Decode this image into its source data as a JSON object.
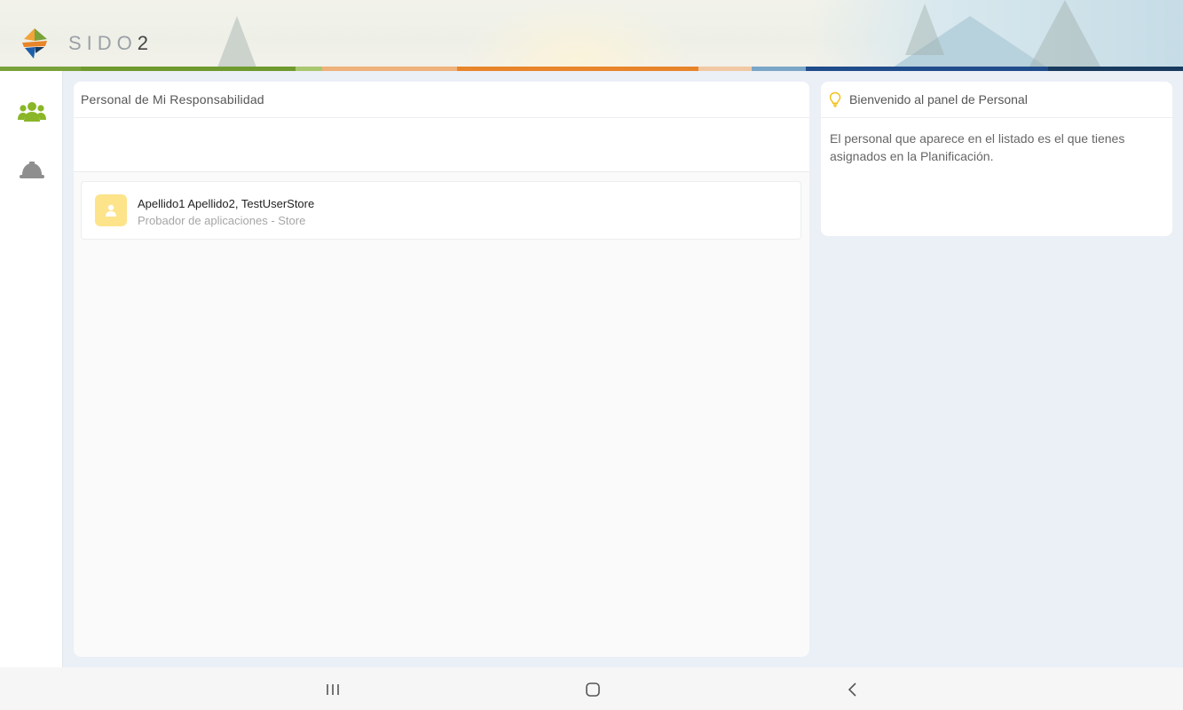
{
  "header": {
    "brand_text": "SIDO",
    "brand_number": "2",
    "logo_icon": "sido-logo-icon",
    "stripe_colors": [
      "#7aa23a",
      "#7aa23a",
      "#a9c76f",
      "#eeb27a",
      "#e8852a",
      "#f0c9a3",
      "#7aa6c7",
      "#1f4c8a",
      "#173a5e"
    ]
  },
  "sidebar": {
    "items": [
      {
        "icon": "users-icon",
        "color": "#8ab627"
      },
      {
        "icon": "hard-hat-icon",
        "color": "#8e8e8e"
      }
    ]
  },
  "main": {
    "title": "Personal de Mi Responsabilidad",
    "people": [
      {
        "name": "Apellido1 Apellido2, TestUserStore",
        "role": "Probador de aplicaciones - Store",
        "icon": "user-avatar-icon",
        "avatar_color": "#fde38a"
      }
    ]
  },
  "info": {
    "icon": "lightbulb-icon",
    "title": "Bienvenido al panel de Personal",
    "body": "El personal que aparece en el listado es el que tienes asignados en la Planificación."
  },
  "navbar": {
    "items": [
      "recent-apps-icon",
      "home-icon",
      "back-icon"
    ]
  }
}
